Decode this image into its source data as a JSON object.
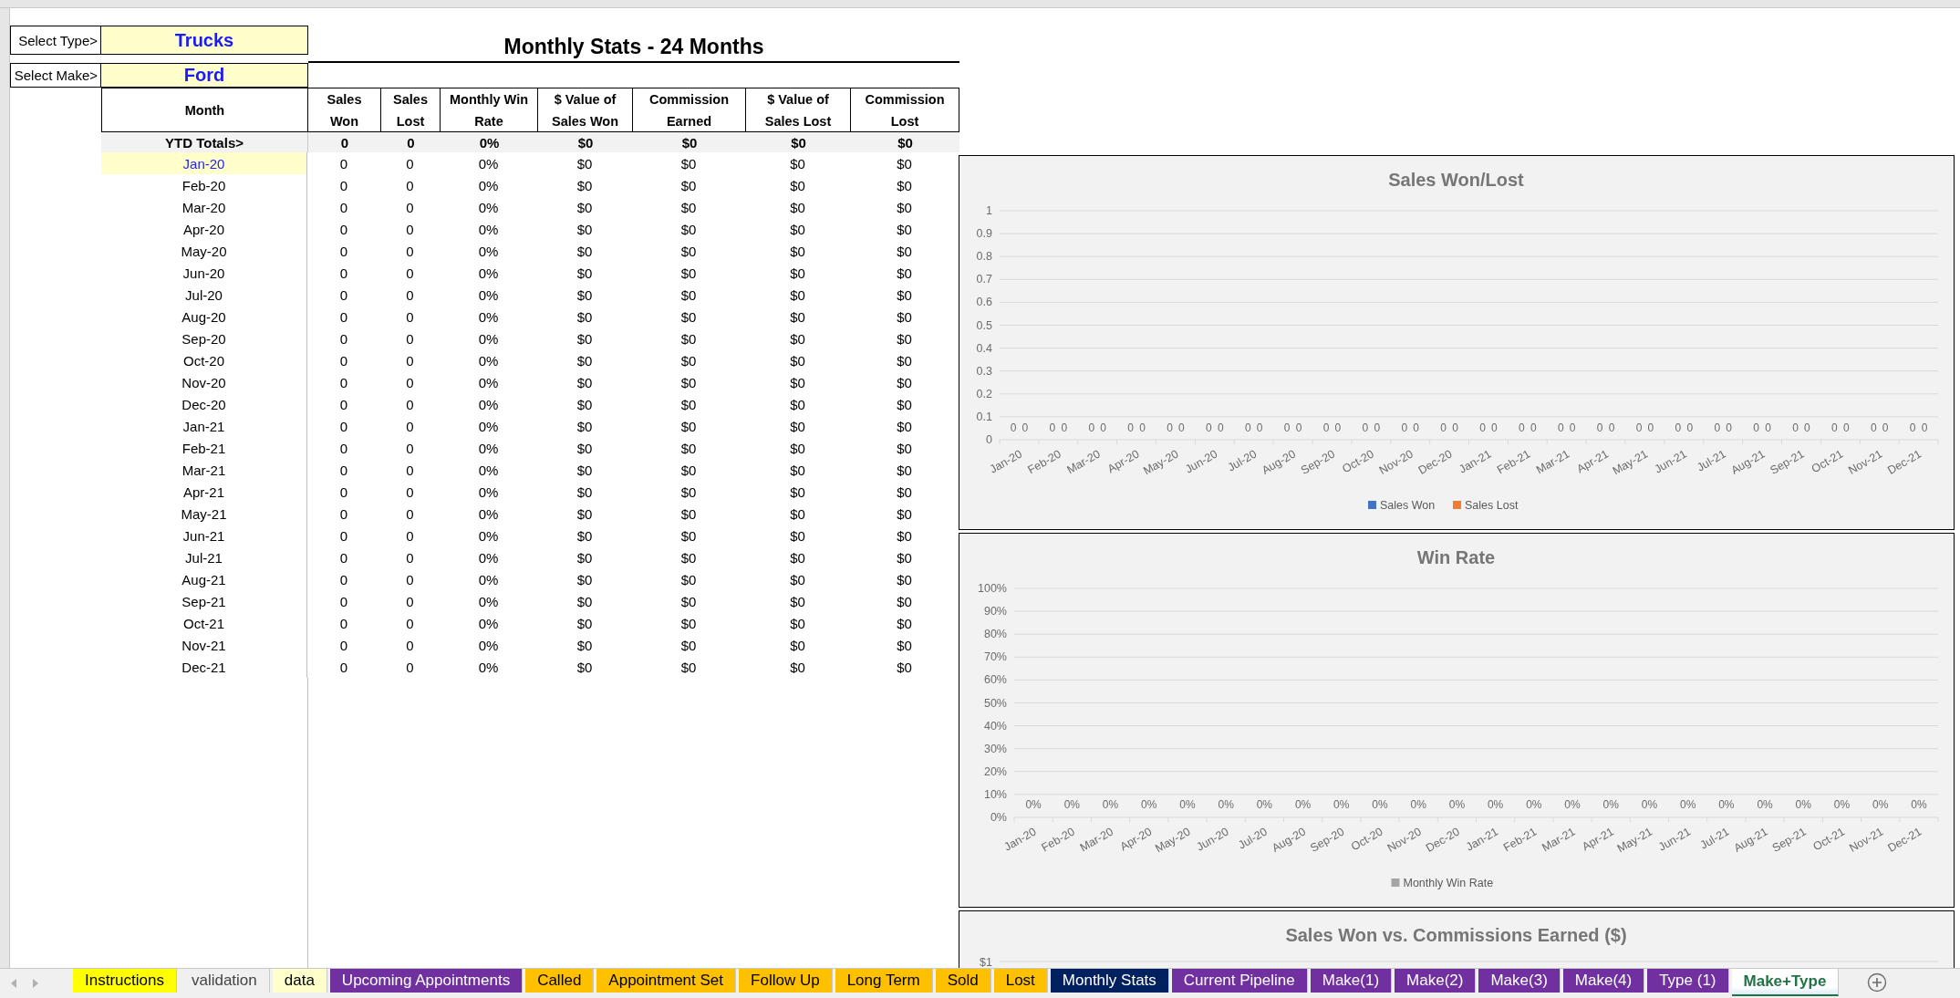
{
  "selectors": [
    {
      "label": "Select Type>",
      "value": "Trucks"
    },
    {
      "label": "Select Make>",
      "value": "Ford"
    }
  ],
  "title": "Monthly Stats - 24 Months",
  "table": {
    "month_header": "Month",
    "columns": [
      "Sales\nWon",
      "Sales\nLost",
      "Monthly Win\nRate",
      "$ Value of\nSales Won",
      "Commission\nEarned",
      "$ Value of\nSales Lost",
      "Commission\nLost"
    ],
    "totals": {
      "label": "YTD Totals>",
      "values": [
        "0",
        "0",
        "0%",
        "$0",
        "$0",
        "$0",
        "$0"
      ]
    },
    "rows": [
      {
        "month": "Jan-20",
        "highlighted": true,
        "values": [
          "0",
          "0",
          "0%",
          "$0",
          "$0",
          "$0",
          "$0"
        ]
      },
      {
        "month": "Feb-20",
        "highlighted": false,
        "values": [
          "0",
          "0",
          "0%",
          "$0",
          "$0",
          "$0",
          "$0"
        ]
      },
      {
        "month": "Mar-20",
        "highlighted": false,
        "values": [
          "0",
          "0",
          "0%",
          "$0",
          "$0",
          "$0",
          "$0"
        ]
      },
      {
        "month": "Apr-20",
        "highlighted": false,
        "values": [
          "0",
          "0",
          "0%",
          "$0",
          "$0",
          "$0",
          "$0"
        ]
      },
      {
        "month": "May-20",
        "highlighted": false,
        "values": [
          "0",
          "0",
          "0%",
          "$0",
          "$0",
          "$0",
          "$0"
        ]
      },
      {
        "month": "Jun-20",
        "highlighted": false,
        "values": [
          "0",
          "0",
          "0%",
          "$0",
          "$0",
          "$0",
          "$0"
        ]
      },
      {
        "month": "Jul-20",
        "highlighted": false,
        "values": [
          "0",
          "0",
          "0%",
          "$0",
          "$0",
          "$0",
          "$0"
        ]
      },
      {
        "month": "Aug-20",
        "highlighted": false,
        "values": [
          "0",
          "0",
          "0%",
          "$0",
          "$0",
          "$0",
          "$0"
        ]
      },
      {
        "month": "Sep-20",
        "highlighted": false,
        "values": [
          "0",
          "0",
          "0%",
          "$0",
          "$0",
          "$0",
          "$0"
        ]
      },
      {
        "month": "Oct-20",
        "highlighted": false,
        "values": [
          "0",
          "0",
          "0%",
          "$0",
          "$0",
          "$0",
          "$0"
        ]
      },
      {
        "month": "Nov-20",
        "highlighted": false,
        "values": [
          "0",
          "0",
          "0%",
          "$0",
          "$0",
          "$0",
          "$0"
        ]
      },
      {
        "month": "Dec-20",
        "highlighted": false,
        "values": [
          "0",
          "0",
          "0%",
          "$0",
          "$0",
          "$0",
          "$0"
        ]
      },
      {
        "month": "Jan-21",
        "highlighted": false,
        "values": [
          "0",
          "0",
          "0%",
          "$0",
          "$0",
          "$0",
          "$0"
        ]
      },
      {
        "month": "Feb-21",
        "highlighted": false,
        "values": [
          "0",
          "0",
          "0%",
          "$0",
          "$0",
          "$0",
          "$0"
        ]
      },
      {
        "month": "Mar-21",
        "highlighted": false,
        "values": [
          "0",
          "0",
          "0%",
          "$0",
          "$0",
          "$0",
          "$0"
        ]
      },
      {
        "month": "Apr-21",
        "highlighted": false,
        "values": [
          "0",
          "0",
          "0%",
          "$0",
          "$0",
          "$0",
          "$0"
        ]
      },
      {
        "month": "May-21",
        "highlighted": false,
        "values": [
          "0",
          "0",
          "0%",
          "$0",
          "$0",
          "$0",
          "$0"
        ]
      },
      {
        "month": "Jun-21",
        "highlighted": false,
        "values": [
          "0",
          "0",
          "0%",
          "$0",
          "$0",
          "$0",
          "$0"
        ]
      },
      {
        "month": "Jul-21",
        "highlighted": false,
        "values": [
          "0",
          "0",
          "0%",
          "$0",
          "$0",
          "$0",
          "$0"
        ]
      },
      {
        "month": "Aug-21",
        "highlighted": false,
        "values": [
          "0",
          "0",
          "0%",
          "$0",
          "$0",
          "$0",
          "$0"
        ]
      },
      {
        "month": "Sep-21",
        "highlighted": false,
        "values": [
          "0",
          "0",
          "0%",
          "$0",
          "$0",
          "$0",
          "$0"
        ]
      },
      {
        "month": "Oct-21",
        "highlighted": false,
        "values": [
          "0",
          "0",
          "0%",
          "$0",
          "$0",
          "$0",
          "$0"
        ]
      },
      {
        "month": "Nov-21",
        "highlighted": false,
        "values": [
          "0",
          "0",
          "0%",
          "$0",
          "$0",
          "$0",
          "$0"
        ]
      },
      {
        "month": "Dec-21",
        "highlighted": false,
        "values": [
          "0",
          "0",
          "0%",
          "$0",
          "$0",
          "$0",
          "$0"
        ]
      }
    ]
  },
  "charts": [
    {
      "chart_data": {
        "type": "bar",
        "title": "Sales Won/Lost",
        "categories": [
          "Jan-20",
          "Feb-20",
          "Mar-20",
          "Apr-20",
          "May-20",
          "Jun-20",
          "Jul-20",
          "Aug-20",
          "Sep-20",
          "Oct-20",
          "Nov-20",
          "Dec-20",
          "Jan-21",
          "Feb-21",
          "Mar-21",
          "Apr-21",
          "May-21",
          "Jun-21",
          "Jul-21",
          "Aug-21",
          "Sep-21",
          "Oct-21",
          "Nov-21",
          "Dec-21"
        ],
        "series": [
          {
            "name": "Sales Won",
            "color": "#4472c4",
            "values": [
              0,
              0,
              0,
              0,
              0,
              0,
              0,
              0,
              0,
              0,
              0,
              0,
              0,
              0,
              0,
              0,
              0,
              0,
              0,
              0,
              0,
              0,
              0,
              0
            ]
          },
          {
            "name": "Sales Lost",
            "color": "#ed7d31",
            "values": [
              0,
              0,
              0,
              0,
              0,
              0,
              0,
              0,
              0,
              0,
              0,
              0,
              0,
              0,
              0,
              0,
              0,
              0,
              0,
              0,
              0,
              0,
              0,
              0
            ]
          }
        ],
        "yticks": [
          0,
          0.1,
          0.2,
          0.3,
          0.4,
          0.5,
          0.6,
          0.7,
          0.8,
          0.9,
          1
        ],
        "ylim": [
          0,
          1
        ],
        "grid": true,
        "data_labels": true
      }
    },
    {
      "chart_data": {
        "type": "bar",
        "title": "Win Rate",
        "categories": [
          "Jan-20",
          "Feb-20",
          "Mar-20",
          "Apr-20",
          "May-20",
          "Jun-20",
          "Jul-20",
          "Aug-20",
          "Sep-20",
          "Oct-20",
          "Nov-20",
          "Dec-20",
          "Jan-21",
          "Feb-21",
          "Mar-21",
          "Apr-21",
          "May-21",
          "Jun-21",
          "Jul-21",
          "Aug-21",
          "Sep-21",
          "Oct-21",
          "Nov-21",
          "Dec-21"
        ],
        "series": [
          {
            "name": "Monthly Win Rate",
            "color": "#a5a5a5",
            "values": [
              0,
              0,
              0,
              0,
              0,
              0,
              0,
              0,
              0,
              0,
              0,
              0,
              0,
              0,
              0,
              0,
              0,
              0,
              0,
              0,
              0,
              0,
              0,
              0
            ]
          }
        ],
        "yticks": [
          {
            "value": 0,
            "label": "0%"
          },
          {
            "value": 0.1,
            "label": "10%"
          },
          {
            "value": 0.2,
            "label": "20%"
          },
          {
            "value": 0.3,
            "label": "30%"
          },
          {
            "value": 0.4,
            "label": "40%"
          },
          {
            "value": 0.5,
            "label": "50%"
          },
          {
            "value": 0.6,
            "label": "60%"
          },
          {
            "value": 0.7,
            "label": "70%"
          },
          {
            "value": 0.8,
            "label": "80%"
          },
          {
            "value": 0.9,
            "label": "90%"
          },
          {
            "value": 1,
            "label": "100%"
          }
        ],
        "ylim": [
          0,
          1
        ],
        "grid": true,
        "value_labels": [
          "0%",
          "0%",
          "0%",
          "0%",
          "0%",
          "0%",
          "0%",
          "0%",
          "0%",
          "0%",
          "0%",
          "0%",
          "0%",
          "0%",
          "0%",
          "0%",
          "0%",
          "0%",
          "0%",
          "0%",
          "0%",
          "0%",
          "0%",
          "0%"
        ]
      }
    }
  ],
  "chart_preview": {
    "title": "Sales Won vs. Commissions Earned ($)",
    "axis_label": "$1"
  },
  "tabs": [
    {
      "label": "Instructions",
      "color": "#ffff00",
      "selected": false
    },
    {
      "label": "validation",
      "selected": false
    },
    {
      "label": "data",
      "color": "#ffffcc",
      "selected": false
    },
    {
      "label": "Upcoming Appointments",
      "color": "#7030a0",
      "selected": false
    },
    {
      "label": "Called",
      "color": "#ffc000",
      "selected": false
    },
    {
      "label": "Appointment Set",
      "color": "#ffc000",
      "selected": false
    },
    {
      "label": "Follow Up",
      "color": "#ffc000",
      "selected": false
    },
    {
      "label": "Long Term",
      "color": "#ffc000",
      "selected": false
    },
    {
      "label": "Sold",
      "color": "#ffc000",
      "selected": false
    },
    {
      "label": "Lost",
      "color": "#ffc000",
      "selected": false
    },
    {
      "label": "Monthly Stats",
      "color": "#002060",
      "selected": false
    },
    {
      "label": "Current Pipeline",
      "color": "#7030a0",
      "selected": false
    },
    {
      "label": "Make(1)",
      "color": "#7030a0",
      "selected": false
    },
    {
      "label": "Make(2)",
      "color": "#7030a0",
      "selected": false
    },
    {
      "label": "Make(3)",
      "color": "#7030a0",
      "selected": false
    },
    {
      "label": "Make(4)",
      "color": "#7030a0",
      "selected": false
    },
    {
      "label": "Type (1)",
      "color": "#7030a0",
      "selected": false
    },
    {
      "label": "Make+Type",
      "selected": true
    }
  ]
}
